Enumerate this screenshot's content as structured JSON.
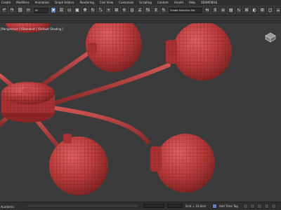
{
  "menu": [
    "Create",
    "Modifiers",
    "Animation",
    "Graph Editors",
    "Rendering",
    "Civil View",
    "Customize",
    "Scripting",
    "Content",
    "Arnold",
    "Help",
    "3DSMOBILE"
  ],
  "toolbar": {
    "selection_filter": "All",
    "named_selection": "Create Selection Set"
  },
  "viewport": {
    "label": "[Perspective ] [Standard ] [Default Shading ]",
    "mesh_color": "#b83a3a",
    "wire_color": "#5a1414",
    "background": "#3b3b3b"
  },
  "status": {
    "left_text": "Academic",
    "grid_label": "Grid = 10.0cm",
    "add_time_tag": "Add Time Tag"
  }
}
